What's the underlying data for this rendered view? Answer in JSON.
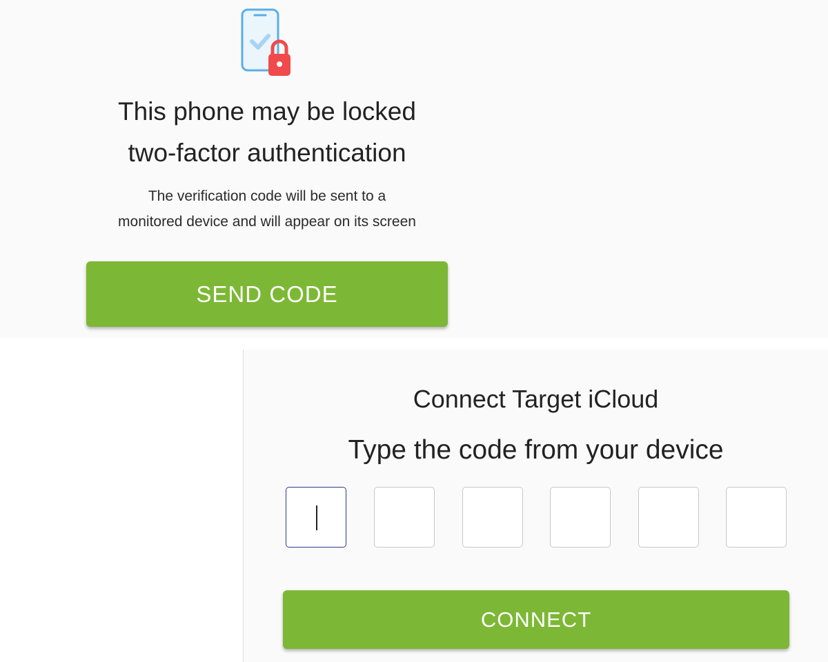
{
  "lock_screen": {
    "icon": "phone-lock-icon",
    "title_line1": "This phone may be locked",
    "title_line2": "two-factor authentication",
    "description_line1": "The verification code will be sent to a",
    "description_line2": "monitored device and will appear on its screen",
    "send_button_label": "SEND CODE"
  },
  "connect_screen": {
    "title": "Connect Target iCloud",
    "subtitle": "Type the code from your device",
    "code_digits": [
      "",
      "",
      "",
      "",
      "",
      ""
    ],
    "connect_button_label": "CONNECT"
  },
  "colors": {
    "button_green": "#7cb835",
    "icon_blue": "#5aaee6",
    "lock_red": "#f04a4a",
    "active_input_border": "#2d3a8c",
    "panel_background": "#fafafa"
  }
}
